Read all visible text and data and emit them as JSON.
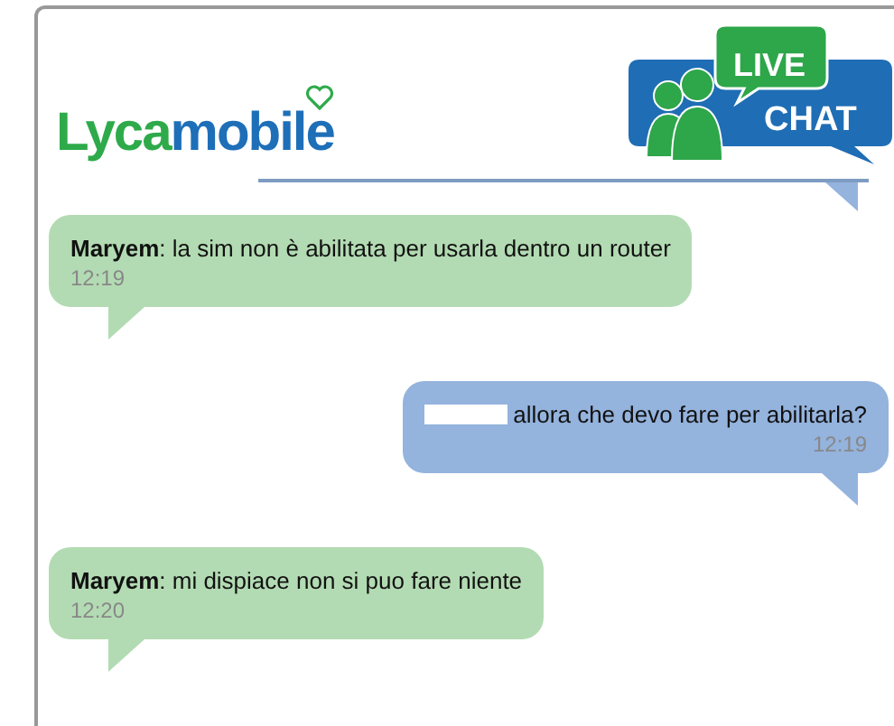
{
  "header": {
    "logo": {
      "part_1": "Lyca",
      "part_2": "mobile"
    },
    "badge": {
      "line_1": "LIVE",
      "line_2": "CHAT"
    }
  },
  "messages": [
    {
      "kind": "agent",
      "text": "**Maryem**: la sim non è abilitata per usarla dentro un router",
      "time": "12:19"
    },
    {
      "kind": "user",
      "sender_redacted": true,
      "text": "allora che devo fare per abilitarla?",
      "time": "12:19"
    },
    {
      "kind": "agent",
      "text": "**Maryem**: mi dispiace non si puo fare niente",
      "time": "12:20"
    }
  ]
}
